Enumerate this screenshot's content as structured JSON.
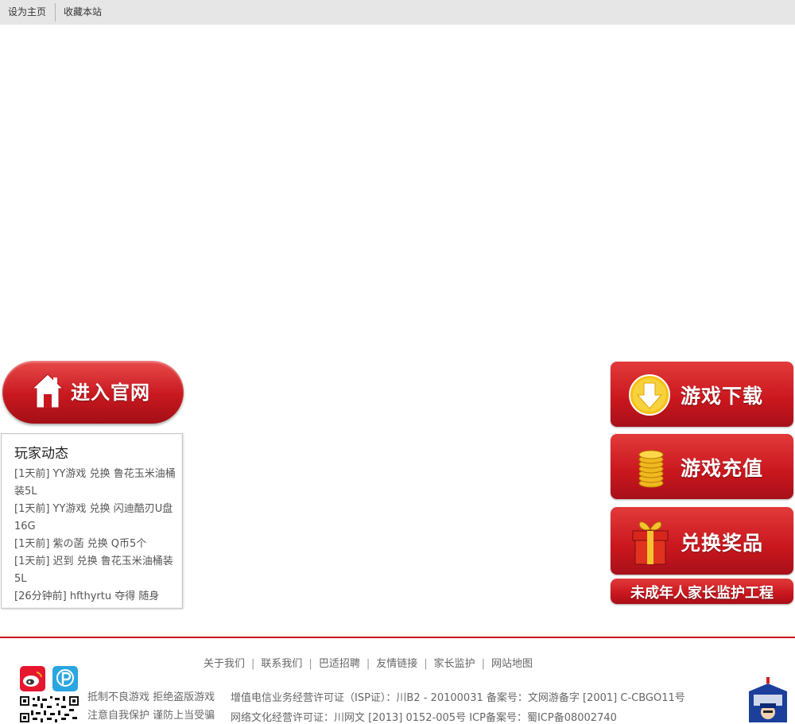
{
  "topbar": {
    "set_home": "设为主页",
    "bookmark": "收藏本站"
  },
  "enter_site": {
    "label": "进入官网",
    "icon": "home-icon"
  },
  "activity": {
    "title": "玩家动态",
    "items": [
      "[1天前] YY游戏 兑换 鲁花玉米油桶装5L",
      "[1天前] YY游戏 兑换 闪迪酷刃U盘16G",
      "[1天前] 紫の菡 兑换 Q币5个",
      "[1天前] 迟到 兑换 鲁花玉米油桶装5L",
      "[26分钟前] hfthyrtu 夺得 随身"
    ]
  },
  "side": {
    "download": {
      "label": "游戏下载",
      "icon": "download-arrow-icon"
    },
    "recharge": {
      "label": "游戏充值",
      "icon": "gold-coins-icon"
    },
    "exchange": {
      "label": "兑换奖品",
      "icon": "gift-box-icon"
    },
    "parent": {
      "label": "未成年人家长监护工程"
    }
  },
  "footer": {
    "links": [
      "关于我们",
      "联系我们",
      "巴适招聘",
      "友情链接",
      "家长监护",
      "网站地图"
    ],
    "slogan_1": "抵制不良游戏 拒绝盗版游戏",
    "slogan_2": "注意自我保护 谨防上当受骗",
    "license_1": "增值电信业务经营许可证（ISP证）：川B2 - 20100031 备案号：文网游备字 [2001] C-CBGO11号",
    "license_2": "网络文化经营许可证：川网文 [2013] 0152-005号 ICP备案号：蜀ICP备08002740"
  },
  "colors": {
    "brand_red": "#c8161d",
    "topbar_bg": "#e6e6e6"
  }
}
